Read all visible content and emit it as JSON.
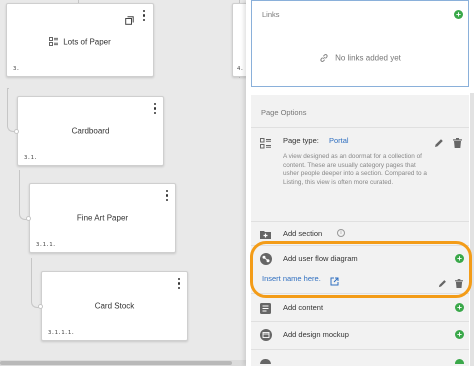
{
  "canvas": {
    "nodes": [
      {
        "title": "Lots of Paper",
        "number": "3.",
        "icon": "page-list-icon",
        "has_duplicate_icon": true
      },
      {
        "title": "Cardboard",
        "number": "3.1."
      },
      {
        "title": "Fine Art Paper",
        "number": "3.1.1."
      },
      {
        "title": "Card Stock",
        "number": "3.1.1.1."
      }
    ],
    "partial_number": "4."
  },
  "links": {
    "header": "Links",
    "empty_text": "No links added yet",
    "empty_icon": "link-icon"
  },
  "page_options": {
    "header": "Page Options",
    "page_type_label": "Page type:",
    "page_type_value": "Portal",
    "page_type_description": "A view designed as an doormat for a collection of content. These are usually category pages that usher people deeper into a section. Compared to a Listing, this view is often more curated.",
    "add_section_label": "Add section",
    "add_user_flow_label": "Add user flow diagram",
    "user_flow_link_text": "Insert name here.",
    "add_content_label": "Add content",
    "add_design_mockup_label": "Add design mockup"
  },
  "colors": {
    "accent_green": "#3aa84a",
    "link_blue": "#2f6fc0",
    "highlight_orange": "#f39c18"
  }
}
